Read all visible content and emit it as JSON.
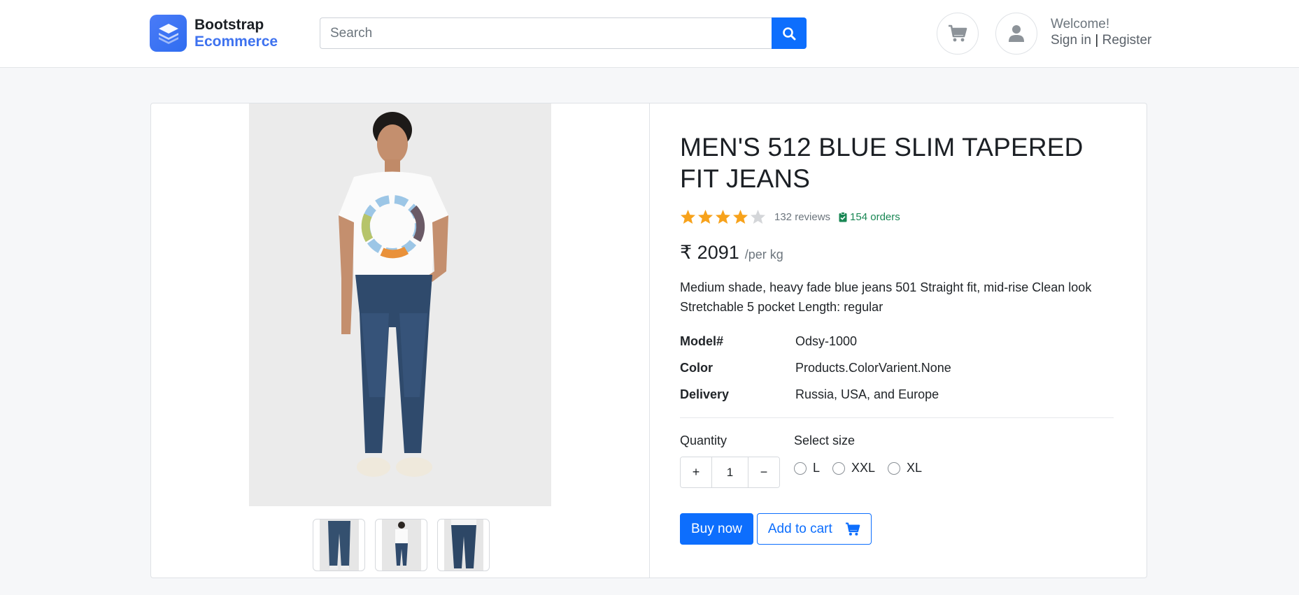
{
  "header": {
    "brand_top": "Bootstrap",
    "brand_bottom": "Ecommerce",
    "search_placeholder": "Search",
    "welcome": "Welcome!",
    "sign_in": "Sign in",
    "separator": "|",
    "register": "Register",
    "icons": [
      "cart-icon",
      "user-icon",
      "search-icon"
    ],
    "accent_color": "#0d6efd"
  },
  "product": {
    "title": "MEN'S 512 BLUE SLIM TAPERED FIT JEANS",
    "rating": 4,
    "rating_max": 5,
    "reviews": "132 reviews",
    "orders": "154 orders",
    "price": "₹ 2091",
    "unit": "/per kg",
    "description": "Medium shade, heavy fade blue jeans 501 Straight fit, mid-rise Clean look Stretchable 5 pocket Length: regular",
    "specs": [
      {
        "key": "Model#",
        "value": "Odsy-1000"
      },
      {
        "key": "Color",
        "value": "Products.ColorVarient.None"
      },
      {
        "key": "Delivery",
        "value": "Russia, USA, and Europe"
      }
    ],
    "quantity_label": "Quantity",
    "quantity_plus": "+",
    "quantity_value": "1",
    "quantity_minus": "−",
    "size_label": "Select size",
    "sizes": [
      "L",
      "XXL",
      "XL"
    ],
    "buy_now": "Buy now",
    "add_to_cart": "Add to cart",
    "star_color": "#f7a21b",
    "orders_color": "#198754"
  }
}
